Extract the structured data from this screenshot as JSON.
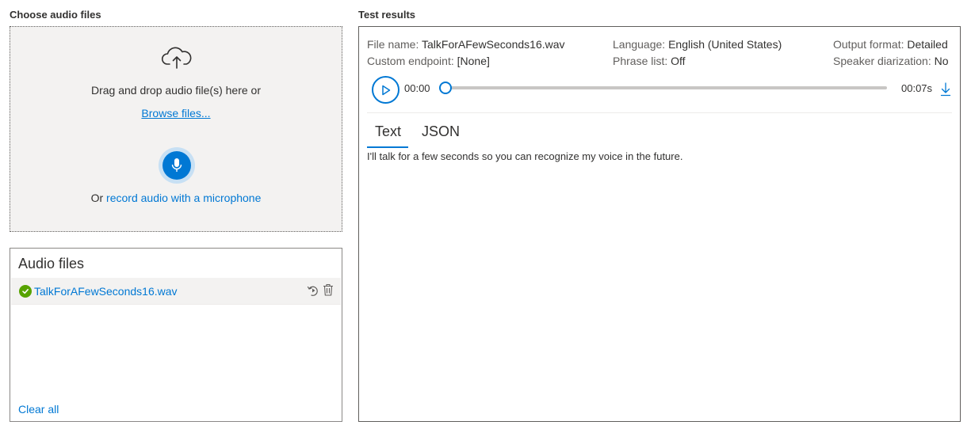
{
  "left": {
    "title": "Choose audio files",
    "dropzone": {
      "drag_text": "Drag and drop audio file(s) here or",
      "browse_label": "Browse files...",
      "record_prefix": "Or ",
      "record_link": "record audio with a microphone"
    },
    "audio_files": {
      "title": "Audio files",
      "items": [
        {
          "name": "TalkForAFewSeconds16.wav",
          "status": "success"
        }
      ],
      "clear_all": "Clear all"
    }
  },
  "results": {
    "title": "Test results",
    "meta": {
      "file_name_label": "File name:",
      "file_name": "TalkForAFewSeconds16.wav",
      "custom_endpoint_label": "Custom endpoint:",
      "custom_endpoint": "[None]",
      "language_label": "Language:",
      "language": "English (United States)",
      "phrase_list_label": "Phrase list:",
      "phrase_list": "Off",
      "output_format_label": "Output format:",
      "output_format": "Detailed",
      "speaker_diarization_label": "Speaker diarization:",
      "speaker_diarization": "No"
    },
    "player": {
      "current_time": "00:00",
      "duration": "00:07s",
      "progress": 0
    },
    "tabs": [
      {
        "label": "Text",
        "selected": true
      },
      {
        "label": "JSON",
        "selected": false
      }
    ],
    "transcript": "I'll talk for a few seconds so you can recognize my voice in the future."
  },
  "colors": {
    "accent": "#0078d4",
    "success": "#57a300",
    "dropzone_bg": "#f3f2f1"
  },
  "icons": [
    "cloud-upload-icon",
    "microphone-icon",
    "check-circle-icon",
    "rerun-icon",
    "trash-icon",
    "play-icon",
    "download-icon"
  ]
}
